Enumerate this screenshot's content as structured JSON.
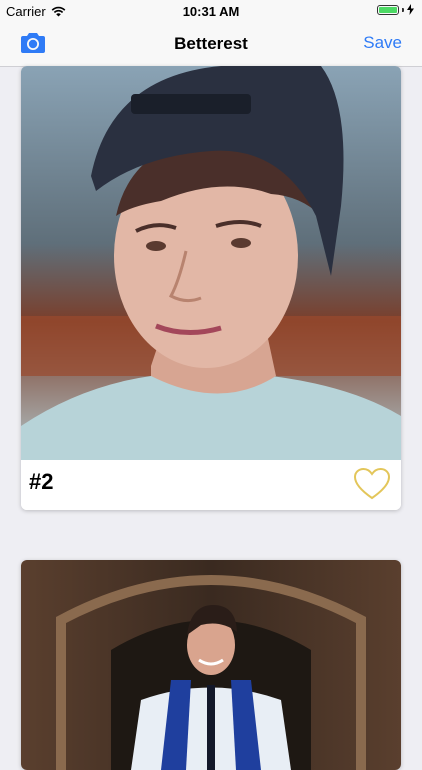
{
  "status_bar": {
    "carrier": "Carrier",
    "time": "10:31 AM",
    "battery_level": 1.0,
    "icons": [
      "wifi-icon",
      "battery-icon",
      "charging-bolt-icon"
    ]
  },
  "nav_bar": {
    "title": "Betterest",
    "save_label": "Save",
    "left_icon": "camera-icon",
    "accent_color": "#2f7bf6"
  },
  "cards": [
    {
      "rank": "#2",
      "favorite_icon": "heart-outline-icon",
      "favorite_color": "#e3c65a",
      "photo": "person-photo-backwards-cap"
    },
    {
      "photo": "person-photo-graduation-stole"
    }
  ]
}
